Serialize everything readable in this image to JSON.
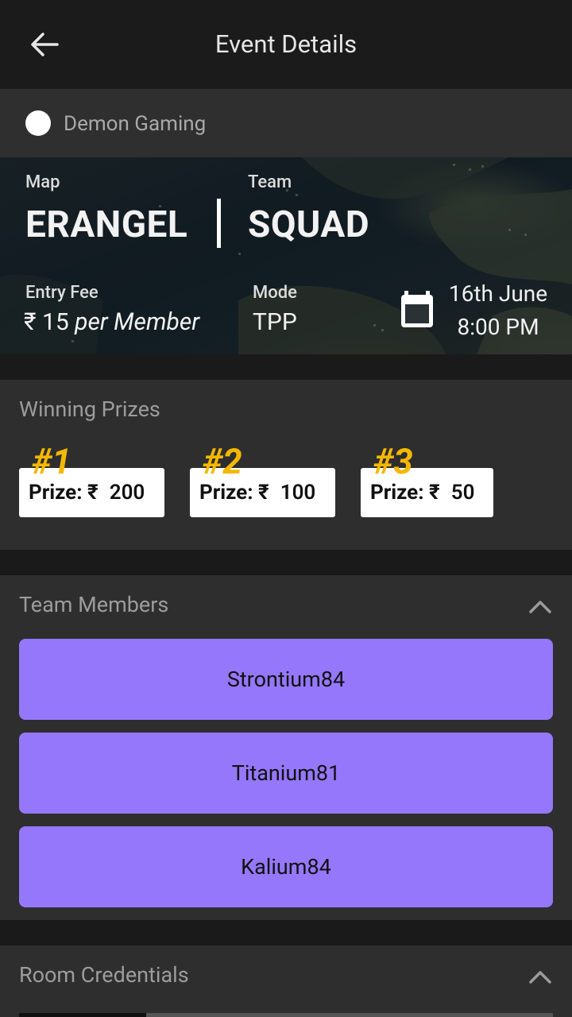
{
  "appbar": {
    "title": "Event Details",
    "back_icon": "arrow-left-icon"
  },
  "organizer": {
    "name": "Demon Gaming"
  },
  "event": {
    "map_label": "Map",
    "map_value": "ERANGEL",
    "team_label": "Team",
    "team_value": "SQUAD",
    "entry_fee_label": "Entry Fee",
    "entry_fee_currency": "₹",
    "entry_fee_amount": "15",
    "entry_fee_suffix": "per Member",
    "mode_label": "Mode",
    "mode_value": "TPP",
    "date": "16th June",
    "time": "8:00 PM",
    "calendar_icon": "calendar-icon"
  },
  "prizes": {
    "title": "Winning Prizes",
    "items": [
      {
        "rank": "#1",
        "label": "Prize:",
        "currency": "₹",
        "amount": "200"
      },
      {
        "rank": "#2",
        "label": "Prize:",
        "currency": "₹",
        "amount": "100"
      },
      {
        "rank": "#3",
        "label": "Prize:",
        "currency": "₹",
        "amount": "50"
      }
    ]
  },
  "team_members": {
    "title": "Team Members",
    "toggle_icon": "chevron-up-icon",
    "members": [
      "Strontium84",
      "Titanium81",
      "Kalium84"
    ]
  },
  "room_credentials": {
    "title": "Room Credentials",
    "toggle_icon": "chevron-up-icon"
  },
  "colors": {
    "accent": "#9577fc",
    "prize_rank": "#f5b800",
    "background": "#1a1a1a",
    "card": "#2e2e2e"
  }
}
